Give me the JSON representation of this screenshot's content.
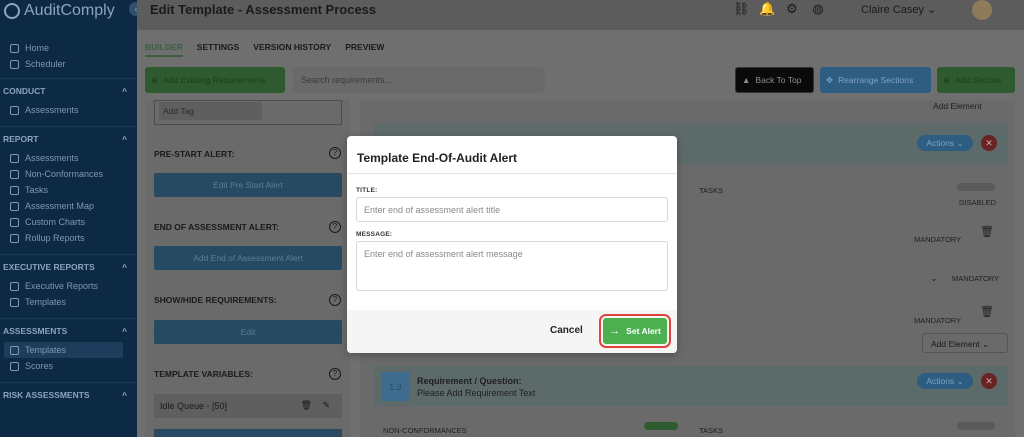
{
  "app": {
    "name": "AuditComply"
  },
  "header": {
    "title": "Edit Template - Assessment Process",
    "user_name": "Claire Casey"
  },
  "sidebar": {
    "items_top": [
      {
        "label": "Home"
      },
      {
        "label": "Scheduler"
      }
    ],
    "sections": [
      {
        "title": "CONDUCT",
        "items": [
          "Assessments"
        ]
      },
      {
        "title": "REPORT",
        "items": [
          "Assessments",
          "Non-Conformances",
          "Tasks",
          "Assessment Map",
          "Custom Charts",
          "Rollup Reports"
        ]
      },
      {
        "title": "EXECUTIVE REPORTS",
        "items": [
          "Executive Reports",
          "Templates"
        ]
      },
      {
        "title": "ASSESSMENTS",
        "items": [
          "Templates",
          "Scores"
        ]
      },
      {
        "title": "RISK ASSESSMENTS",
        "items": []
      }
    ]
  },
  "tabs": [
    "BUILDER",
    "SETTINGS",
    "VERSION HISTORY",
    "PREVIEW"
  ],
  "toolbar": {
    "add_existing": "Add Existing Requirements",
    "search_placeholder": "Search requirements...",
    "back_to_top": "Back To Top",
    "rearrange": "Rearrange Sections",
    "add_section": "Add Section"
  },
  "left_panel": {
    "add_tag": "Add Tag",
    "pre_start_label": "PRE-START ALERT:",
    "pre_start_button": "Edit Pre Start Alert",
    "end_label": "END OF ASSESSMENT ALERT:",
    "end_button": "Add End of Assessment Alert",
    "show_hide_label": "SHOW/HIDE REQUIREMENTS:",
    "edit_button": "Edit",
    "template_vars_label": "TEMPLATE VARIABLES:",
    "variable_item": "Idle Queue - [50]"
  },
  "right_panel": {
    "add_element": "Add Element",
    "actions": "Actions",
    "tasks": "TASKS",
    "disabled": "DISABLED",
    "mandatory": "MANDATORY",
    "section_number": "1.3",
    "requirement_label": "Requirement / Question:",
    "requirement_text": "Please Add Requirement Text",
    "non_conformances": "NON-CONFORMANCES"
  },
  "modal": {
    "title": "Template End-Of-Audit Alert",
    "title_label": "TITLE:",
    "title_placeholder": "Enter end of assessment alert title",
    "message_label": "MESSAGE:",
    "message_placeholder": "Enter end of assessment alert message",
    "cancel": "Cancel",
    "set_alert": "Set Alert"
  }
}
